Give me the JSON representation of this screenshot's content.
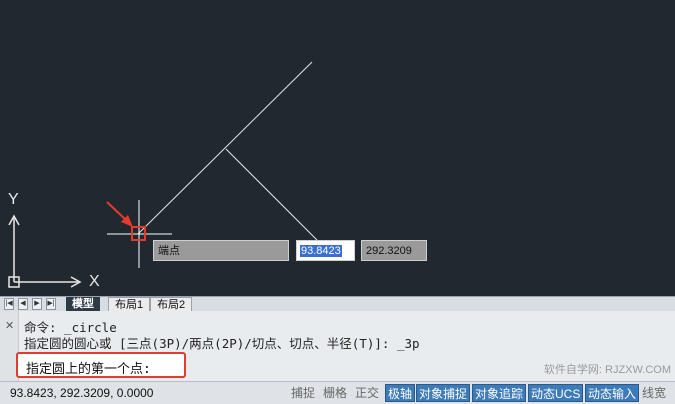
{
  "canvas": {
    "axis_y_label": "Y",
    "axis_x_label": "X",
    "snap_tooltip": "端点",
    "x_input": "93.8423",
    "y_input": "292.3209"
  },
  "tabs": {
    "model": "模型",
    "layout1": "布局1",
    "layout2": "布局2"
  },
  "command": {
    "line1": "命令: _circle",
    "line2": "指定圆的圆心或 [三点(3P)/两点(2P)/切点、切点、半径(T)]: _3p",
    "prompt": "指定圆上的第一个点:",
    "watermark": "软件自学网: RJZXW.COM"
  },
  "status": {
    "coordinates": "93.8423, 292.3209, 0.0000",
    "snap": "捕捉",
    "grid": "栅格",
    "ortho": "正交",
    "polar": "极轴",
    "osnap": "对象捕捉",
    "otrack": "对象追踪",
    "ducs": "动态UCS",
    "dyn": "动态输入",
    "lineweight": "线宽"
  },
  "colors": {
    "canvas_bg": "#212830",
    "highlight": "#e63a2c",
    "status_on": "#3d7ab8"
  }
}
